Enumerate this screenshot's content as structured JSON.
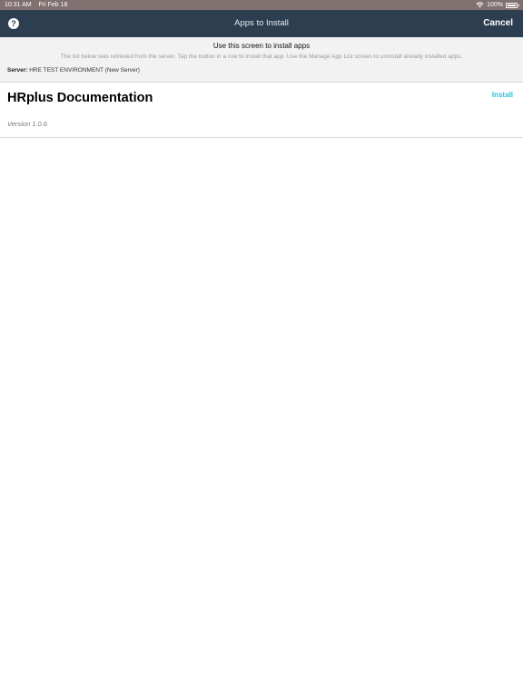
{
  "status_bar": {
    "time": "10:31 AM",
    "date": "Fri Feb 18",
    "battery": "100%",
    "wifi_icon": "wifi-icon",
    "battery_icon": "battery-icon"
  },
  "nav": {
    "help_label": "?",
    "title": "Apps to Install",
    "cancel_label": "Cancel",
    "background": "#2c3e50"
  },
  "info": {
    "heading": "Use this screen to install apps",
    "description": "The list below was retrieved from the server. Tap the button in a row to install that app. Use the Manage App List screen to uninstall already installed apps.",
    "server_label": "Server:",
    "server_value": "HRE TEST ENVIRONMENT (New Server)"
  },
  "apps": [
    {
      "name": "HRplus Documentation",
      "version": "Version 1.0.6",
      "action_label": "Install"
    }
  ],
  "colors": {
    "accent": "#1ec8e6"
  }
}
